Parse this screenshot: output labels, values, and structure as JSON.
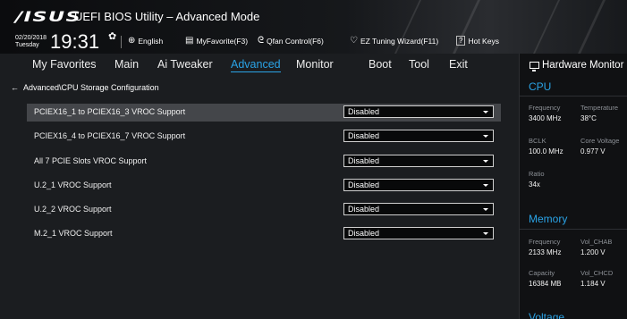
{
  "header": {
    "logo": "/ISUS",
    "title": "UEFI BIOS Utility – Advanced Mode",
    "date": "02/20/2018",
    "day": "Tuesday",
    "time": "19:31",
    "tools": [
      {
        "icon": "globe-icon",
        "label": "English"
      },
      {
        "icon": "favorites-icon",
        "label": "MyFavorite(F3)"
      },
      {
        "icon": "fan-icon",
        "label": "Qfan Control(F6)"
      },
      {
        "icon": "bulb-icon",
        "label": "EZ Tuning Wizard(F11)"
      },
      {
        "icon": "help-icon",
        "label": "Hot Keys"
      }
    ],
    "help_glyph": "?"
  },
  "tabs": [
    "My Favorites",
    "Main",
    "Ai Tweaker",
    "Advanced",
    "Monitor",
    "Boot",
    "Tool",
    "Exit"
  ],
  "active_tab": "Advanced",
  "breadcrumb": "Advanced\\CPU Storage Configuration",
  "settings": [
    {
      "label": "PCIEX16_1 to PCIEX16_3 VROC Support",
      "value": "Disabled"
    },
    {
      "label": "PCIEX16_4 to PCIEX16_7 VROC Support",
      "value": "Disabled"
    },
    {
      "label": "All 7 PCIE Slots VROC Support",
      "value": "Disabled"
    },
    {
      "label": "U.2_1 VROC Support",
      "value": "Disabled"
    },
    {
      "label": "U.2_2 VROC Support",
      "value": "Disabled"
    },
    {
      "label": "M.2_1 VROC Support",
      "value": "Disabled"
    }
  ],
  "hw_monitor": {
    "title": "Hardware Monitor",
    "cpu": {
      "heading": "CPU",
      "frequency_label": "Frequency",
      "frequency": "3400 MHz",
      "temperature_label": "Temperature",
      "temperature": "38°C",
      "bclk_label": "BCLK",
      "bclk": "100.0 MHz",
      "core_voltage_label": "Core Voltage",
      "core_voltage": "0.977 V",
      "ratio_label": "Ratio",
      "ratio": "34x"
    },
    "memory": {
      "heading": "Memory",
      "frequency_label": "Frequency",
      "frequency": "2133 MHz",
      "vol_chab_label": "Vol_CHAB",
      "vol_chab": "1.200 V",
      "capacity_label": "Capacity",
      "capacity": "16384 MB",
      "vol_chcd_label": "Vol_CHCD",
      "vol_chcd": "1.184 V"
    },
    "voltage_heading": "Voltage"
  },
  "colors": {
    "accent": "#2aa3e6",
    "selected_row": "#44464a",
    "background": "#1b1d20"
  }
}
